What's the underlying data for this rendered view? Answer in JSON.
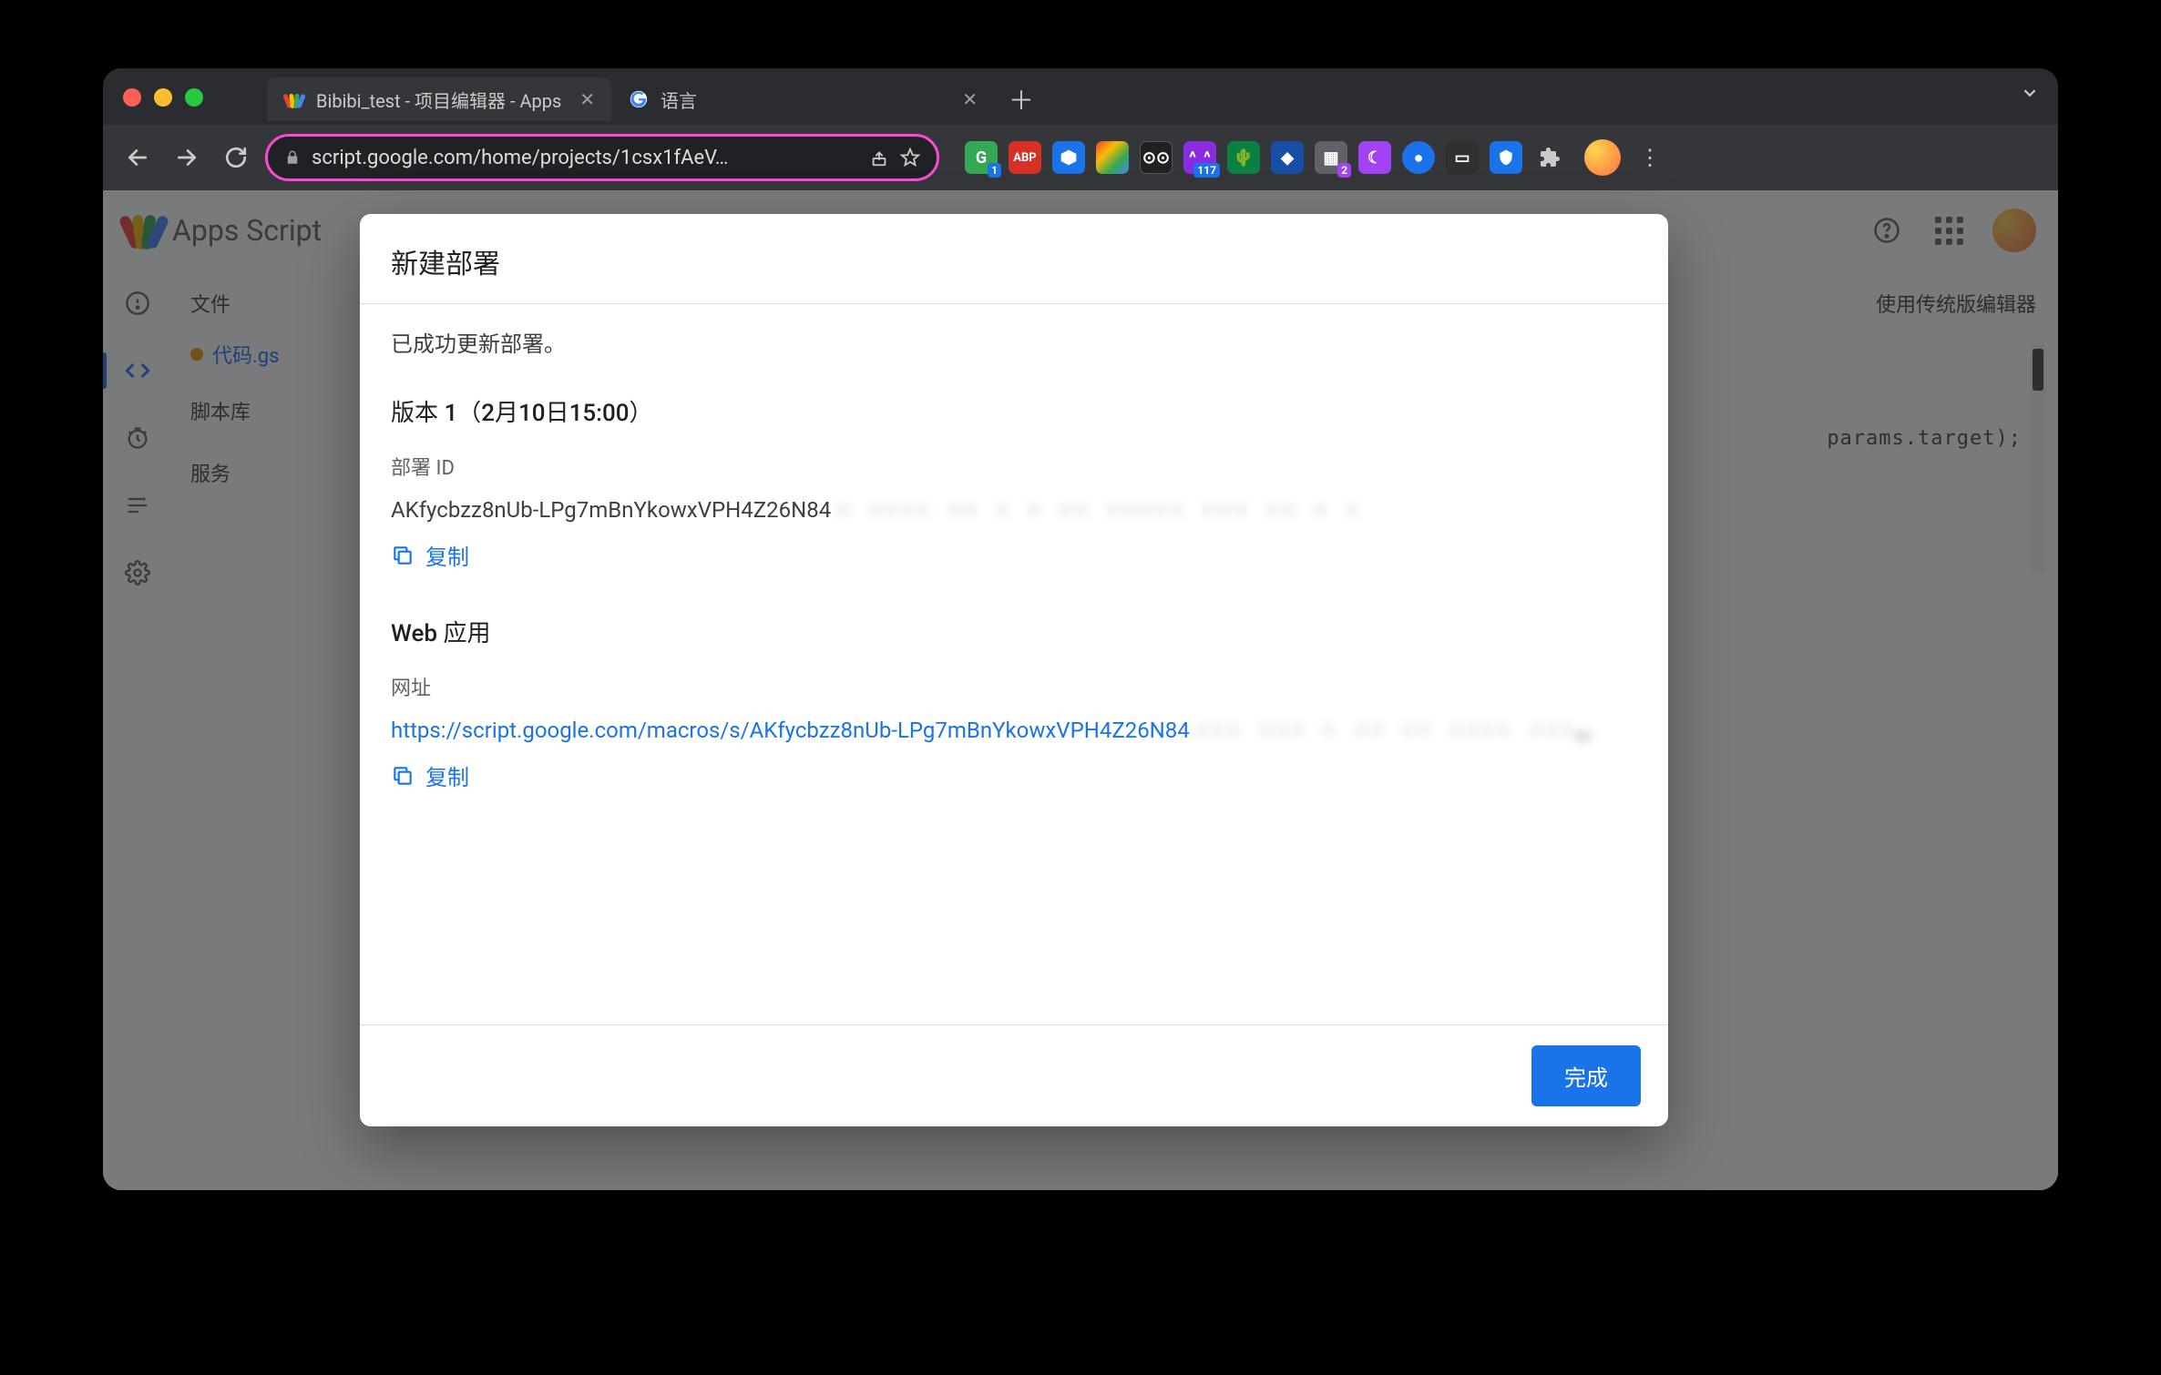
{
  "browser": {
    "tabs": [
      {
        "title": "Bibibi_test - 项目编辑器 - Apps",
        "active": true
      },
      {
        "title": "语言",
        "active": false
      }
    ],
    "url": "script.google.com/home/projects/1csx1fAeV…",
    "extension_badges": {
      "first": "1",
      "abp": "ABP",
      "count117": "117",
      "count2": "2"
    }
  },
  "apps_script": {
    "product": "Apps Script",
    "sidebar": {
      "files_header": "文件",
      "file_name": "代码.gs",
      "library": "脚本库",
      "services": "服务"
    },
    "legacy_link": "使用传统版编辑器",
    "code_hint": "params.target);"
  },
  "modal": {
    "title": "新建部署",
    "success_msg": "已成功更新部署。",
    "version_heading": "版本 1（2月10日15:00）",
    "deploy_id_label": "部署 ID",
    "deploy_id_visible": "AKfycbzz8nUb-LPg7mBnYkowxVPH4Z26N84",
    "deploy_id_hidden": "·  ···· ·· ·  · ·· ····· ··· ·· ·  ·",
    "copy_label": "复制",
    "web_app_heading": "Web 应用",
    "url_label": "网址",
    "url_visible": "https://script.google.com/macros/s/AKfycbzz8nUb-LPg7mBnYkowxVPH4Z26N84",
    "url_hidden": "··· ··· · ·· ·· ···· ···…",
    "done_label": "完成"
  }
}
